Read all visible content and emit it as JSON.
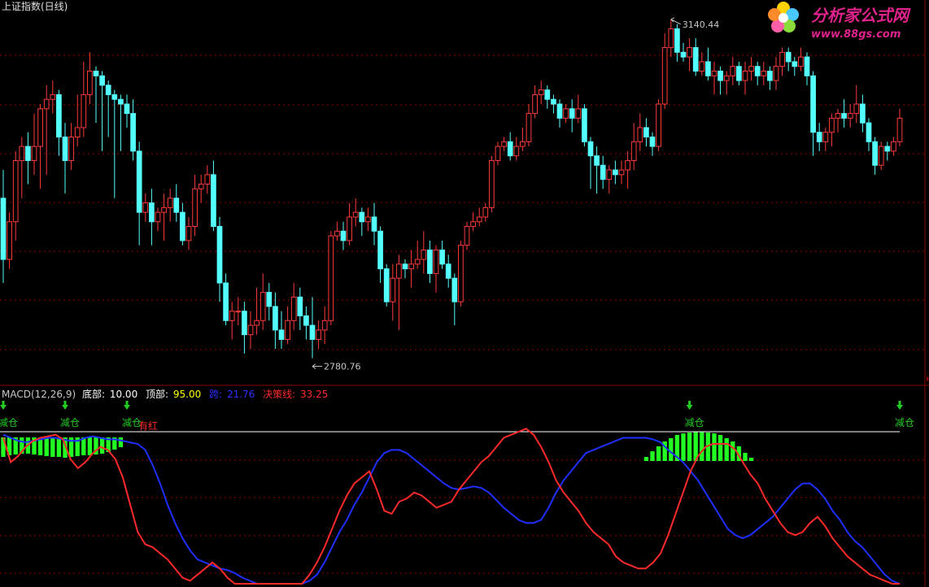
{
  "window_title": "上证指数(日线)",
  "logo": {
    "name": "分析家公式网",
    "url": "www.88gs.com"
  },
  "colors": {
    "up": "#ff3b3b",
    "down": "#54ffff",
    "grid": "#8b0000",
    "diff": "#ff2a2a",
    "dea": "#1f2fff",
    "hist": "#22ff22",
    "signal": "#22cc22",
    "ref_line": "#ffffff",
    "bg": "#000000"
  },
  "price_annotations": {
    "high_label": "3140.44",
    "low_label": "2780.76"
  },
  "indicator_legend": {
    "name": "MACD(12,26,9)",
    "bottom_label": "底部:",
    "bottom_value": "10.00",
    "top_label": "顶部:",
    "top_value": "95.00",
    "line2_label": "跨:",
    "line2_value": "21.76",
    "decision_label": "决策线:",
    "decision_value": "33.25"
  },
  "signals": [
    {
      "text": "减仓",
      "bar": 0
    },
    {
      "text": "减仓",
      "bar": 10
    },
    {
      "text": "减仓",
      "bar": 20
    },
    {
      "text": "减仓",
      "bar": 111
    },
    {
      "text": "减仓",
      "bar": 145
    }
  ],
  "note_label": "有红",
  "chart_data": [
    {
      "type": "candlestick",
      "title": "上证指数(日线)",
      "price_high": 3140.44,
      "price_low": 2780.76,
      "ylim": [
        2765,
        3145
      ],
      "candles": [
        [
          2950,
          2885,
          2980,
          2860
        ],
        [
          2885,
          2925,
          2935,
          2875
        ],
        [
          2925,
          2990,
          3000,
          2905
        ],
        [
          2990,
          3005,
          3015,
          2950
        ],
        [
          3005,
          2990,
          3020,
          2965
        ],
        [
          2990,
          3005,
          3040,
          2975
        ],
        [
          3005,
          3045,
          3050,
          2960
        ],
        [
          3045,
          3055,
          3070,
          2975
        ],
        [
          3055,
          3060,
          3075,
          3040
        ],
        [
          3060,
          3015,
          3065,
          2995
        ],
        [
          3015,
          2990,
          3030,
          2955
        ],
        [
          2990,
          3015,
          3030,
          2980
        ],
        [
          3015,
          3025,
          3060,
          3005
        ],
        [
          3025,
          3060,
          3095,
          3015
        ],
        [
          3060,
          3085,
          3105,
          3050
        ],
        [
          3085,
          3080,
          3090,
          3030
        ],
        [
          3080,
          3070,
          3085,
          3000
        ],
        [
          3070,
          3060,
          3075,
          3015
        ],
        [
          3060,
          3055,
          3065,
          2950
        ],
        [
          3055,
          3050,
          3060,
          3000
        ],
        [
          3050,
          3040,
          3060,
          3025
        ],
        [
          3040,
          3000,
          3055,
          2990
        ],
        [
          3000,
          2935,
          3010,
          2900
        ],
        [
          2935,
          2945,
          2955,
          2925
        ],
        [
          2945,
          2925,
          2960,
          2900
        ],
        [
          2925,
          2935,
          2940,
          2915
        ],
        [
          2935,
          2940,
          2955,
          2905
        ],
        [
          2940,
          2950,
          2960,
          2925
        ],
        [
          2950,
          2935,
          2965,
          2925
        ],
        [
          2935,
          2905,
          2945,
          2900
        ],
        [
          2905,
          2920,
          2930,
          2895
        ],
        [
          2920,
          2960,
          2975,
          2910
        ],
        [
          2960,
          2965,
          2975,
          2945
        ],
        [
          2965,
          2975,
          2985,
          2955
        ],
        [
          2975,
          2920,
          2990,
          2915
        ],
        [
          2920,
          2860,
          2930,
          2840
        ],
        [
          2860,
          2820,
          2870,
          2815
        ],
        [
          2820,
          2830,
          2840,
          2800
        ],
        [
          2830,
          2830,
          2845,
          2815
        ],
        [
          2830,
          2805,
          2840,
          2785
        ],
        [
          2805,
          2815,
          2830,
          2790
        ],
        [
          2815,
          2820,
          2855,
          2805
        ],
        [
          2820,
          2850,
          2870,
          2810
        ],
        [
          2850,
          2835,
          2860,
          2820
        ],
        [
          2835,
          2810,
          2850,
          2790
        ],
        [
          2810,
          2800,
          2830,
          2790
        ],
        [
          2800,
          2820,
          2835,
          2795
        ],
        [
          2820,
          2845,
          2860,
          2810
        ],
        [
          2845,
          2825,
          2855,
          2810
        ],
        [
          2825,
          2815,
          2835,
          2800
        ],
        [
          2815,
          2800,
          2845,
          2780
        ],
        [
          2800,
          2810,
          2820,
          2790
        ],
        [
          2810,
          2820,
          2835,
          2795
        ],
        [
          2820,
          2910,
          2915,
          2815
        ],
        [
          2910,
          2915,
          2925,
          2905
        ],
        [
          2915,
          2905,
          2925,
          2895
        ],
        [
          2905,
          2930,
          2945,
          2900
        ],
        [
          2930,
          2935,
          2950,
          2920
        ],
        [
          2935,
          2925,
          2940,
          2910
        ],
        [
          2925,
          2930,
          2940,
          2915
        ],
        [
          2930,
          2915,
          2945,
          2900
        ],
        [
          2915,
          2875,
          2920,
          2860
        ],
        [
          2875,
          2840,
          2880,
          2835
        ],
        [
          2840,
          2865,
          2880,
          2820
        ],
        [
          2865,
          2880,
          2890,
          2810
        ],
        [
          2880,
          2875,
          2885,
          2865
        ],
        [
          2875,
          2880,
          2895,
          2855
        ],
        [
          2880,
          2885,
          2905,
          2875
        ],
        [
          2885,
          2895,
          2915,
          2870
        ],
        [
          2895,
          2870,
          2905,
          2860
        ],
        [
          2870,
          2895,
          2900,
          2850
        ],
        [
          2895,
          2880,
          2905,
          2875
        ],
        [
          2880,
          2865,
          2890,
          2855
        ],
        [
          2865,
          2840,
          2870,
          2815
        ],
        [
          2840,
          2900,
          2905,
          2835
        ],
        [
          2900,
          2920,
          2925,
          2895
        ],
        [
          2920,
          2925,
          2935,
          2915
        ],
        [
          2925,
          2930,
          2940,
          2920
        ],
        [
          2930,
          2940,
          2945,
          2925
        ],
        [
          2940,
          2990,
          2995,
          2935
        ],
        [
          2990,
          3005,
          3010,
          2985
        ],
        [
          3005,
          3010,
          3015,
          3000
        ],
        [
          3010,
          2995,
          3020,
          2990
        ],
        [
          2995,
          3005,
          3015,
          2990
        ],
        [
          3005,
          3010,
          3025,
          3000
        ],
        [
          3010,
          3040,
          3050,
          3005
        ],
        [
          3040,
          3060,
          3070,
          3035
        ],
        [
          3060,
          3065,
          3075,
          3050
        ],
        [
          3065,
          3055,
          3070,
          3045
        ],
        [
          3055,
          3050,
          3060,
          3040
        ],
        [
          3050,
          3035,
          3055,
          3025
        ],
        [
          3035,
          3045,
          3050,
          3030
        ],
        [
          3045,
          3035,
          3055,
          3020
        ],
        [
          3035,
          3045,
          3060,
          3030
        ],
        [
          3045,
          3010,
          3050,
          3005
        ],
        [
          3010,
          2995,
          3015,
          2960
        ],
        [
          2995,
          2985,
          3005,
          2955
        ],
        [
          2985,
          2970,
          2995,
          2960
        ],
        [
          2970,
          2980,
          2985,
          2955
        ],
        [
          2980,
          2975,
          2990,
          2965
        ],
        [
          2975,
          2980,
          2990,
          2965
        ],
        [
          2980,
          2990,
          3000,
          2960
        ],
        [
          2990,
          3010,
          3030,
          2980
        ],
        [
          3010,
          3025,
          3040,
          3000
        ],
        [
          3025,
          3015,
          3035,
          3005
        ],
        [
          3015,
          3005,
          3020,
          2995
        ],
        [
          3005,
          3050,
          3055,
          3000
        ],
        [
          3050,
          3110,
          3125,
          3045
        ],
        [
          3110,
          3130,
          3140,
          3100
        ],
        [
          3130,
          3105,
          3135,
          3095
        ],
        [
          3105,
          3100,
          3115,
          3095
        ],
        [
          3100,
          3110,
          3120,
          3085
        ],
        [
          3110,
          3085,
          3120,
          3080
        ],
        [
          3085,
          3095,
          3105,
          3080
        ],
        [
          3095,
          3080,
          3110,
          3075
        ],
        [
          3080,
          3085,
          3095,
          3060
        ],
        [
          3085,
          3075,
          3090,
          3060
        ],
        [
          3075,
          3080,
          3085,
          3060
        ],
        [
          3080,
          3090,
          3100,
          3070
        ],
        [
          3090,
          3075,
          3095,
          3070
        ],
        [
          3075,
          3085,
          3095,
          3060
        ],
        [
          3085,
          3090,
          3100,
          3075
        ],
        [
          3090,
          3080,
          3095,
          3070
        ],
        [
          3080,
          3085,
          3095,
          3070
        ],
        [
          3085,
          3075,
          3090,
          3065
        ],
        [
          3075,
          3090,
          3100,
          3065
        ],
        [
          3090,
          3105,
          3110,
          3080
        ],
        [
          3105,
          3095,
          3110,
          3085
        ],
        [
          3095,
          3090,
          3100,
          3080
        ],
        [
          3090,
          3100,
          3110,
          3085
        ],
        [
          3100,
          3080,
          3105,
          3070
        ],
        [
          3080,
          3020,
          3085,
          2995
        ],
        [
          3020,
          3010,
          3030,
          3000
        ],
        [
          3010,
          3020,
          3025,
          3000
        ],
        [
          3020,
          3035,
          3040,
          3005
        ],
        [
          3035,
          3040,
          3045,
          3020
        ],
        [
          3040,
          3035,
          3055,
          3025
        ],
        [
          3035,
          3040,
          3050,
          3025
        ],
        [
          3040,
          3050,
          3070,
          3030
        ],
        [
          3050,
          3030,
          3060,
          3020
        ],
        [
          3030,
          3010,
          3035,
          3000
        ],
        [
          3010,
          2985,
          3015,
          2975
        ],
        [
          2985,
          3005,
          3010,
          2980
        ],
        [
          3005,
          3000,
          3010,
          2990
        ],
        [
          3000,
          3010,
          3015,
          2995
        ],
        [
          3010,
          3035,
          3045,
          3005
        ]
      ]
    },
    {
      "type": "line",
      "title": "MACD(12,26,9)",
      "ylim": [
        0,
        100
      ],
      "reference_line": 100,
      "series": [
        {
          "name": "跨",
          "color": "#1f2fff",
          "values": [
            98,
            96,
            94,
            93,
            94,
            95,
            96,
            96,
            95,
            94,
            94,
            96,
            97,
            96,
            95,
            95,
            94,
            93,
            92,
            88,
            78,
            66,
            52,
            40,
            30,
            22,
            16,
            14,
            12,
            10,
            9,
            7,
            4,
            2,
            0,
            0,
            0,
            0,
            0,
            0,
            0,
            2,
            6,
            14,
            24,
            34,
            42,
            52,
            60,
            70,
            80,
            86,
            88,
            88,
            86,
            82,
            78,
            74,
            70,
            66,
            63,
            62,
            63,
            64,
            63,
            60,
            55,
            50,
            46,
            42,
            40,
            40,
            42,
            50,
            60,
            68,
            74,
            80,
            86,
            88,
            90,
            92,
            94,
            96,
            96,
            96,
            96,
            95,
            93,
            88,
            84,
            80,
            74,
            68,
            60,
            52,
            44,
            36,
            32,
            30,
            32,
            36,
            40,
            44,
            50,
            56,
            62,
            66,
            66,
            62,
            56,
            48,
            42,
            34,
            28,
            24,
            18,
            12,
            6,
            2,
            0
          ]
        },
        {
          "name": "决策线",
          "color": "#ff2a2a",
          "values": [
            96,
            80,
            84,
            90,
            94,
            96,
            97,
            98,
            95,
            82,
            76,
            80,
            86,
            90,
            88,
            82,
            70,
            52,
            34,
            26,
            24,
            20,
            16,
            10,
            4,
            2,
            6,
            10,
            14,
            10,
            4,
            0,
            0,
            0,
            0,
            0,
            0,
            0,
            0,
            0,
            0,
            6,
            14,
            24,
            36,
            48,
            58,
            66,
            70,
            74,
            62,
            48,
            46,
            54,
            56,
            60,
            58,
            54,
            50,
            52,
            54,
            62,
            68,
            74,
            80,
            84,
            90,
            96,
            98,
            100,
            102,
            98,
            90,
            80,
            68,
            60,
            54,
            48,
            40,
            34,
            30,
            26,
            18,
            14,
            12,
            10,
            10,
            14,
            20,
            32,
            46,
            60,
            74,
            84,
            90,
            92,
            92,
            92,
            88,
            80,
            72,
            66,
            56,
            48,
            40,
            34,
            32,
            34,
            40,
            44,
            38,
            30,
            24,
            18,
            14,
            10,
            6,
            4,
            2,
            0,
            0
          ]
        }
      ],
      "histogram_values": [
        24,
        22,
        21,
        20,
        20,
        21,
        22,
        23,
        24,
        24,
        25,
        24,
        23,
        22,
        22,
        21,
        20,
        18,
        15,
        12,
        0,
        0,
        0,
        0,
        0,
        0,
        0,
        0,
        0,
        0,
        0,
        0,
        0,
        0,
        0,
        0,
        0,
        0,
        0,
        0,
        0,
        0,
        0,
        0,
        0,
        0,
        0,
        0,
        0,
        0,
        0,
        0,
        0,
        0,
        0,
        0,
        0,
        0,
        0,
        0,
        0,
        0,
        0,
        0,
        0,
        0,
        0,
        0,
        0,
        0,
        0,
        0,
        0,
        0,
        0,
        0,
        0,
        0,
        0,
        0,
        0,
        0,
        0,
        0,
        0,
        0,
        0,
        0,
        0,
        0,
        0,
        0,
        0,
        0,
        0,
        0,
        0,
        0,
        0,
        0,
        0,
        0,
        0,
        0,
        0,
        0,
        0,
        0,
        0,
        0,
        0,
        0,
        0,
        0,
        0,
        0,
        0,
        0,
        0,
        0,
        0,
        0,
        0,
        0,
        0,
        0,
        0,
        0,
        0,
        0,
        0,
        0,
        0,
        0,
        0,
        0,
        0,
        0,
        0,
        0,
        0,
        0,
        0,
        0,
        0,
        0
      ]
    }
  ]
}
